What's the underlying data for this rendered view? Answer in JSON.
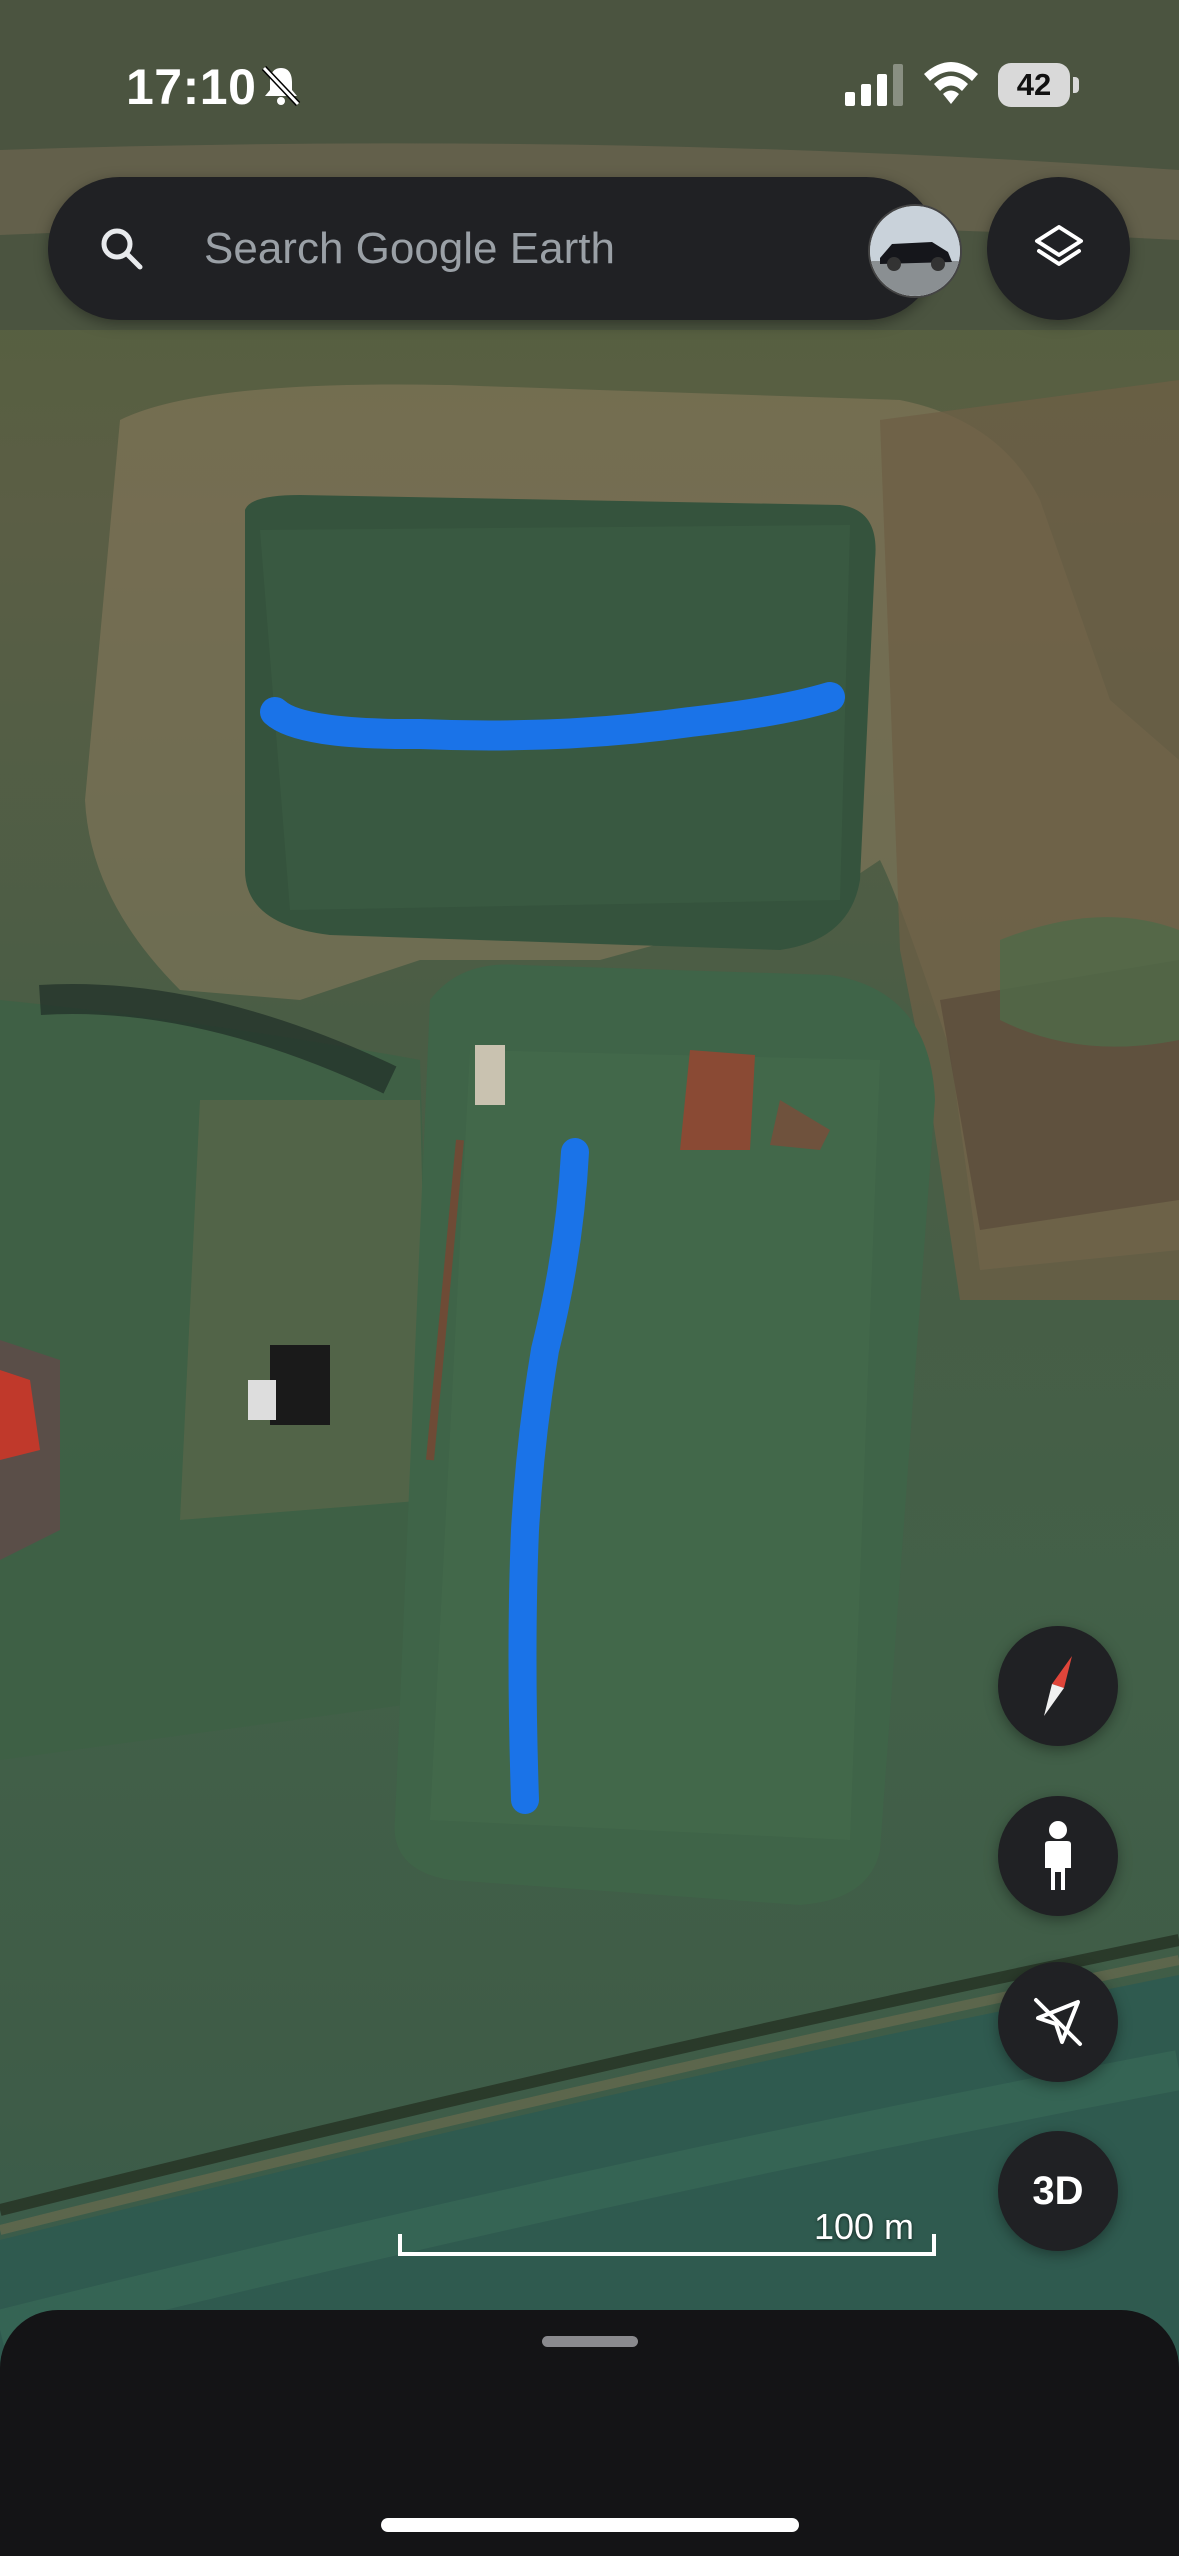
{
  "status_bar": {
    "time": "17:10",
    "battery": "42",
    "battery_level": 0.42,
    "icons": [
      "bell-slash-icon",
      "cellular-signal-icon",
      "wifi-icon",
      "battery-icon"
    ]
  },
  "search": {
    "placeholder": "Search Google Earth",
    "icon": "search-icon",
    "avatar": "profile-avatar"
  },
  "map_controls": {
    "layers": "layers-icon",
    "compass": "compass-icon",
    "street_view": "pegman-icon",
    "location": "location-off-icon",
    "view_3d_label": "3D"
  },
  "scale_bar": {
    "label": "100 m"
  },
  "colors": {
    "drawn_path": "#1a73e8",
    "panel": "#202124",
    "sheet": "#141416",
    "compass_red": "#e0453a"
  }
}
